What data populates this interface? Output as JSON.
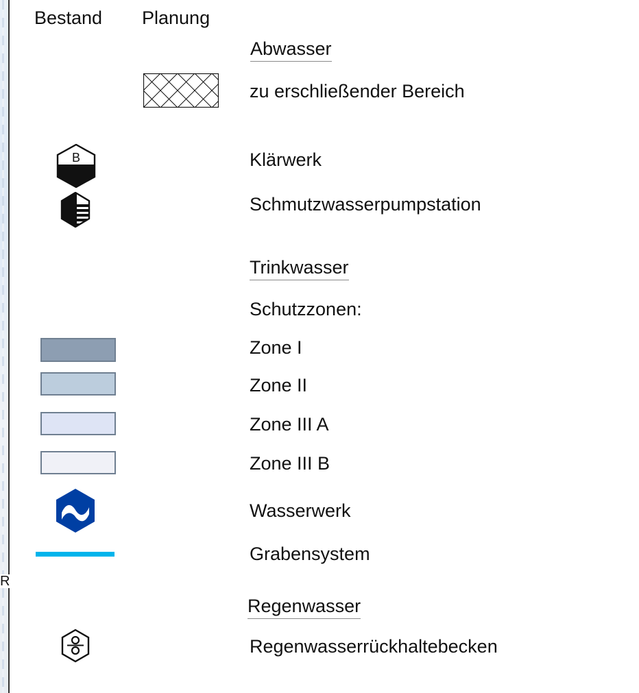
{
  "header": {
    "existing": "Bestand",
    "planned": "Planung"
  },
  "map_edge_letter": "R",
  "sections": {
    "abwasser": {
      "title": "Abwasser",
      "items": [
        {
          "label": "zu erschließender Bereich",
          "icon": "crosshatch-area-icon"
        },
        {
          "label": "Klärwerk",
          "icon": "hexagon-b-icon",
          "symbol_letter": "B"
        },
        {
          "label": "Schmutzwasserpumpstation",
          "icon": "pump-station-icon"
        }
      ]
    },
    "trinkwasser": {
      "title": "Trinkwasser",
      "subtitle": "Schutzzonen:",
      "zones": [
        {
          "label": "Zone I",
          "color": "#8d9eb2"
        },
        {
          "label": "Zone II",
          "color": "#bccddd"
        },
        {
          "label": "Zone III A",
          "color": "#dee4f5"
        },
        {
          "label": "Zone III B",
          "color": "#f0f1f7"
        }
      ],
      "items": [
        {
          "label": "Wasserwerk",
          "icon": "waterworks-icon",
          "color": "#003fa3"
        },
        {
          "label": "Grabensystem",
          "icon": "ditch-line-icon",
          "color": "#00b4ec"
        }
      ]
    },
    "regenwasser": {
      "title": "Regenwasser",
      "items": [
        {
          "label": "Regenwasserrückhaltebecken",
          "icon": "retention-basin-icon"
        }
      ]
    }
  }
}
